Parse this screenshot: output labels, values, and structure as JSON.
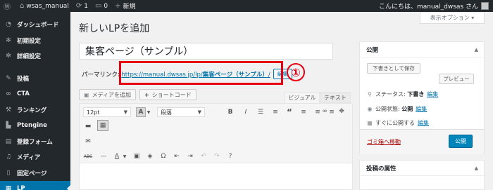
{
  "adminbar": {
    "site_name": "wsas_manual",
    "updates_count": "1",
    "comments_count": "0",
    "new_label": "新規",
    "greeting": "こんにちは、manual_dwsas さん"
  },
  "sidebar": {
    "items": [
      {
        "icon": "dashboard-icon",
        "label": "ダッシュボード"
      },
      {
        "icon": "gear-icon",
        "label": "初期設定"
      },
      {
        "icon": "gear-icon",
        "label": "詳細設定"
      },
      {
        "icon": "pin-icon",
        "label": "投稿"
      },
      {
        "icon": "link-icon",
        "label": "CTA"
      },
      {
        "icon": "wrench-icon",
        "label": "ランキング"
      },
      {
        "icon": "ptengine-icon",
        "label": "Ptengine"
      },
      {
        "icon": "form-icon",
        "label": "登録フォーム"
      },
      {
        "icon": "media-icon",
        "label": "メディア"
      },
      {
        "icon": "page-icon",
        "label": "固定ページ"
      },
      {
        "icon": "lp-icon",
        "label": "LP"
      }
    ]
  },
  "main": {
    "page_title": "新しいLPを追加",
    "screen_options": "表示オプション ▾",
    "post_title": "集客ページ（サンプル）",
    "permalink": {
      "label": "パーマリンク:",
      "url_base": "https://manual.dwsas.jp/lp/",
      "slug": "集客ページ（サンプル）",
      "trailing": "/",
      "edit_label": "編集"
    },
    "callout_number": "①",
    "add_media": "メディアを追加",
    "shortcode": "ショートコード",
    "tab_visual": "ビジュアル",
    "tab_text": "テキスト",
    "editor": {
      "font_size": "12pt",
      "paragraph": "段落"
    }
  },
  "publish_box": {
    "title": "公開",
    "save_draft": "下書きとして保存",
    "preview": "プレビュー",
    "status_label": "ステータス:",
    "status_value": "下書き",
    "visibility_label": "公開状態:",
    "visibility_value": "公開",
    "schedule_label": "すぐに公開する",
    "edit_link": "編集",
    "trash_link": "ゴミ箱へ移動",
    "publish_button": "公開"
  },
  "attributes_box": {
    "title": "投稿の属性"
  },
  "colors": {
    "admin_dark": "#23282d",
    "accent": "#0073aa",
    "highlight": "#e60012"
  }
}
